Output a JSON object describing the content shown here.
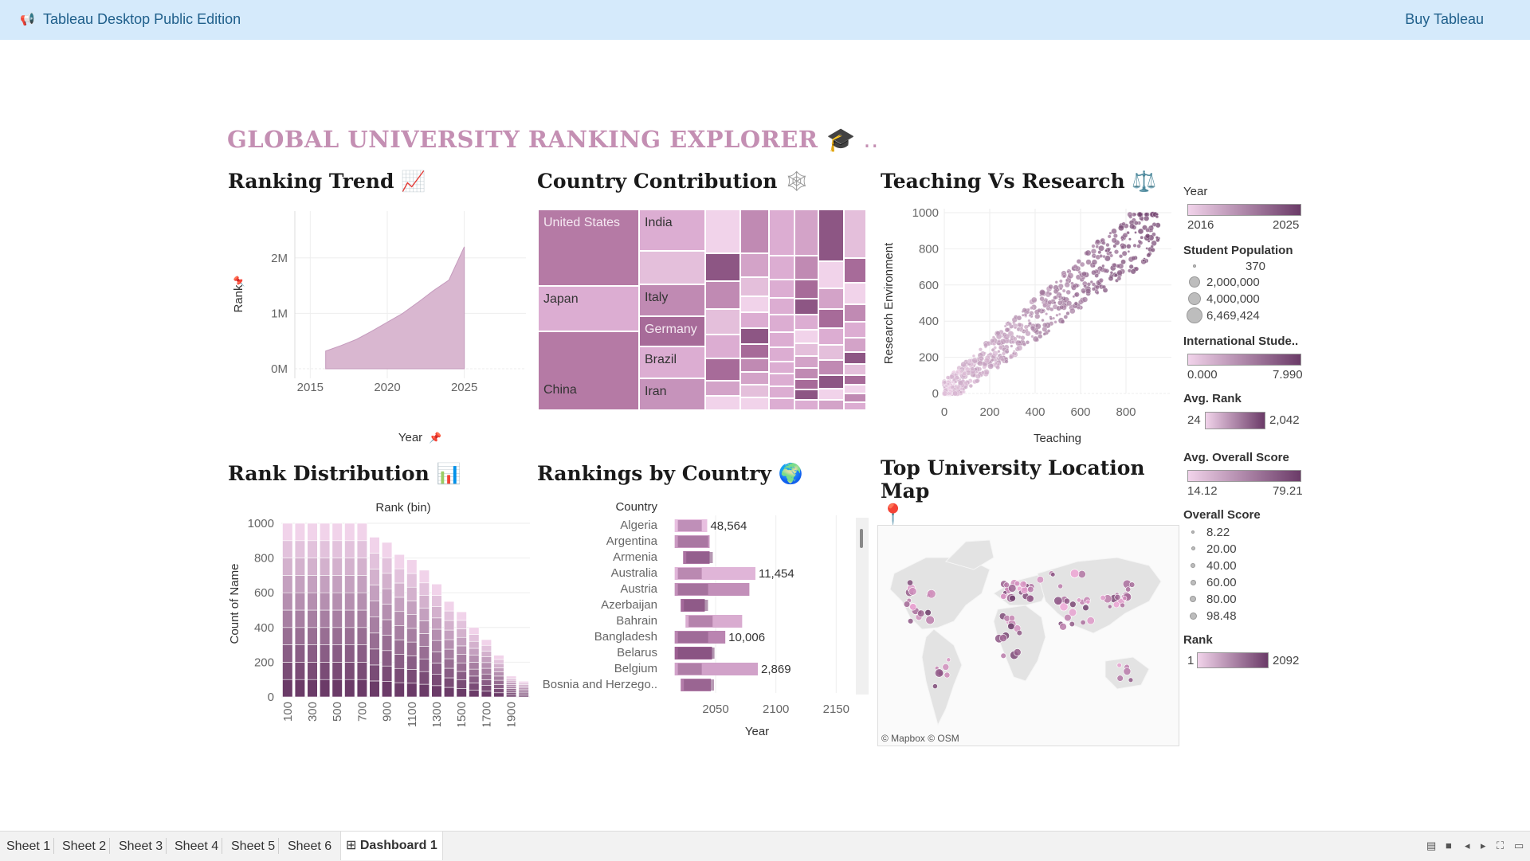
{
  "topbar": {
    "title": "Tableau Desktop Public Edition",
    "buy": "Buy Tableau",
    "icon": "megaphone-icon"
  },
  "dashboard": {
    "title": "GLOBAL UNIVERSITY RANKING EXPLORER",
    "title_emoji": "🎓 ..",
    "accent": "#c48fb3"
  },
  "sheets": {
    "ranking_trend": {
      "title": "Ranking Trend",
      "emoji": "📈"
    },
    "country_contribution": {
      "title": "Country Contribution",
      "emoji": "🕸"
    },
    "teaching_research": {
      "title": "Teaching Vs Research",
      "emoji": "⚖️"
    },
    "rank_distribution": {
      "title": "Rank Distribution",
      "emoji": "📊"
    },
    "rankings_by_country": {
      "title": "Rankings by Country",
      "emoji": "🌍"
    },
    "location_map": {
      "title": "Top University Location Map",
      "emoji": "📍",
      "credit": "© Mapbox © OSM"
    }
  },
  "chart_data": [
    {
      "id": "ranking_trend",
      "type": "area",
      "x": [
        2016,
        2017,
        2018,
        2019,
        2020,
        2021,
        2022,
        2023,
        2024,
        2025
      ],
      "values": [
        320000,
        420000,
        530000,
        680000,
        840000,
        1000000,
        1200000,
        1410000,
        1600000,
        2200000
      ],
      "xlabel": "Year",
      "ylabel": "Rank",
      "x_ticks": [
        "2015",
        "2020",
        "2025"
      ],
      "y_ticks": [
        "0M",
        "1M",
        "2M"
      ],
      "xlim": [
        2014,
        2029
      ],
      "ylim": [
        -100000,
        2700000
      ],
      "color": "#d9b7d0"
    },
    {
      "id": "country_contribution",
      "type": "treemap",
      "labels": [
        "United States",
        "India",
        "Japan",
        "Italy",
        "Germany",
        "Brazil",
        "China",
        "Iran"
      ]
    },
    {
      "id": "teaching_research",
      "type": "scatter",
      "xlabel": "Teaching",
      "ylabel": "Research Environment",
      "x_ticks": [
        "0",
        "200",
        "400",
        "600",
        "800"
      ],
      "y_ticks": [
        "0",
        "200",
        "400",
        "600",
        "800",
        "1000"
      ],
      "xlim": [
        0,
        1000
      ],
      "ylim": [
        0,
        1000
      ]
    },
    {
      "id": "rank_distribution",
      "type": "bar",
      "title": "Rank (bin)",
      "categories": [
        "100",
        "200",
        "300",
        "400",
        "500",
        "600",
        "700",
        "800",
        "900",
        "1000",
        "1100",
        "1200",
        "1300",
        "1400",
        "1500",
        "1600",
        "1700",
        "1800",
        "1900",
        "2000"
      ],
      "tick_labels": [
        "100",
        "300",
        "500",
        "700",
        "900",
        "1100",
        "1300",
        "1500",
        "1700",
        "1900"
      ],
      "values": [
        1000,
        1000,
        1000,
        1000,
        1000,
        1000,
        1000,
        920,
        890,
        820,
        790,
        730,
        650,
        550,
        490,
        400,
        330,
        240,
        120,
        90
      ],
      "ylabel": "Count of Name",
      "y_ticks": [
        "0",
        "200",
        "400",
        "600",
        "800",
        "1000"
      ],
      "ylim": [
        0,
        1000
      ]
    },
    {
      "id": "rankings_by_country",
      "type": "bar",
      "orientation": "horizontal",
      "header": "Country",
      "categories": [
        "Algeria",
        "Argentina",
        "Armenia",
        "Australia",
        "Austria",
        "Azerbaijan",
        "Bahrain",
        "Bangladesh",
        "Belarus",
        "Belgium",
        "Bosnia and Herzego.."
      ],
      "start": [
        2016,
        2016,
        2023,
        2016,
        2016,
        2021,
        2025,
        2016,
        2016,
        2016,
        2021
      ],
      "end": [
        2043,
        2045,
        2045,
        2083,
        2078,
        2041,
        2072,
        2058,
        2047,
        2085,
        2046
      ],
      "labels": [
        "48,564",
        "",
        "",
        "11,454",
        "",
        "",
        "",
        "10,006",
        "",
        "2,869",
        ""
      ],
      "xlabel": "Year",
      "x_ticks": [
        "2050",
        "2100",
        "2150"
      ],
      "xlim": [
        2005,
        2165
      ]
    }
  ],
  "legends": {
    "year": {
      "title": "Year",
      "min": "2016",
      "max": "2025"
    },
    "student_population": {
      "title": "Student Population",
      "items": [
        "370",
        "2,000,000",
        "4,000,000",
        "6,469,424"
      ]
    },
    "international": {
      "title": "International Stude..",
      "min": "0.000",
      "max": "7.990"
    },
    "avg_rank": {
      "title": "Avg. Rank",
      "min": "24",
      "max": "2,042"
    },
    "avg_overall": {
      "title": "Avg. Overall Score",
      "min": "14.12",
      "max": "79.21"
    },
    "overall_score": {
      "title": "Overall Score",
      "items": [
        "8.22",
        "20.00",
        "40.00",
        "60.00",
        "80.00",
        "98.48"
      ]
    },
    "rank": {
      "title": "Rank",
      "min": "1",
      "max": "2092"
    }
  },
  "tabs": [
    "Sheet 1",
    "Sheet 2",
    "Sheet 3",
    "Sheet 4",
    "Sheet 5",
    "Sheet 6",
    "Dashboard 1"
  ],
  "active_tab": "Dashboard 1",
  "colors": {
    "light": "#f1d3ea",
    "mid": "#b57da7",
    "dark": "#6b3b68",
    "topbar": "#d5eafb"
  }
}
